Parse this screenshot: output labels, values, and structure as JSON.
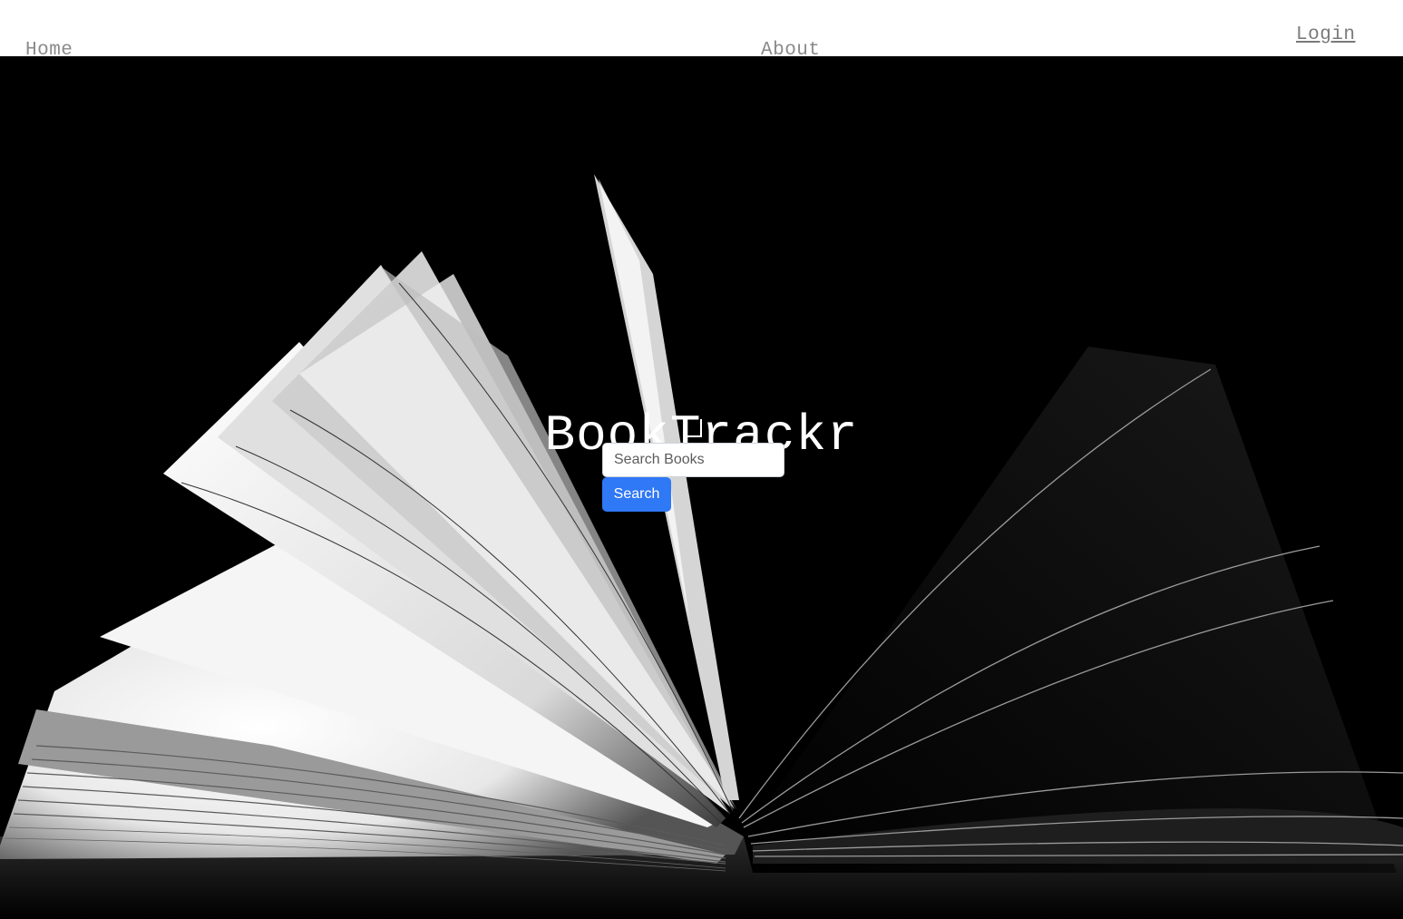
{
  "nav": {
    "home_label": "Home",
    "about_label": "About",
    "login_label": "Login"
  },
  "hero": {
    "title": "BookTrackr",
    "background_image": "open-book-photo"
  },
  "search": {
    "placeholder": "Search Books",
    "value": "",
    "button_label": "Search"
  },
  "colors": {
    "nav_text": "#8a8a8a",
    "hero_background": "#000000",
    "button": "#2f78f6",
    "title_text": "#ffffff"
  }
}
